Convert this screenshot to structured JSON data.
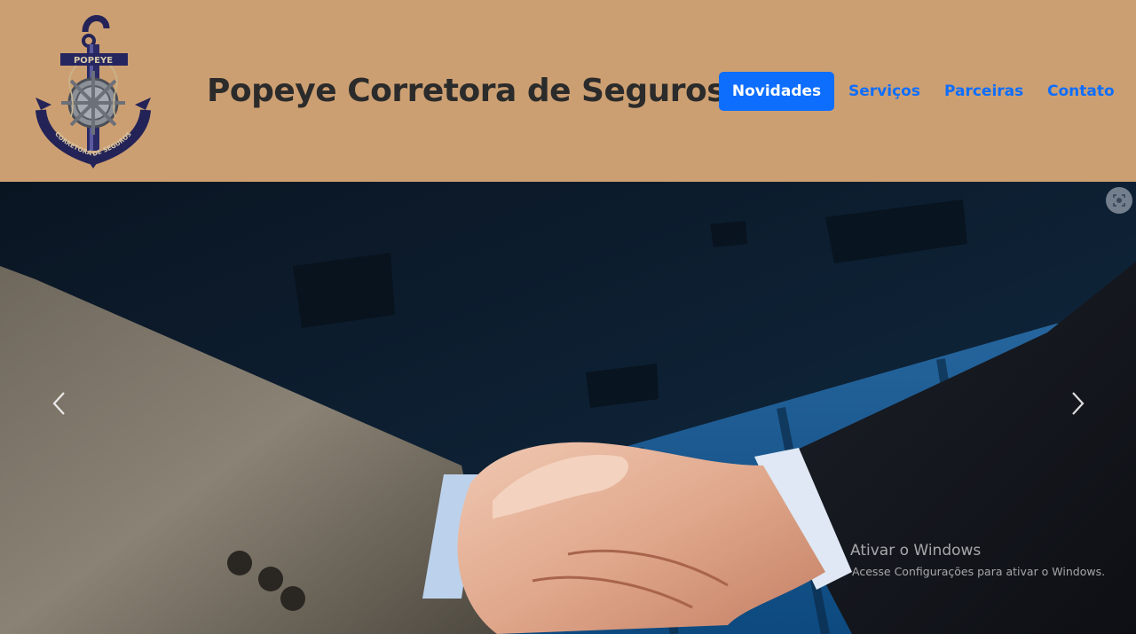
{
  "header": {
    "title": "Popeye Corretora de Seguros",
    "logo": {
      "icon": "anchor-icon",
      "top_text": "POPEYE",
      "bottom_text": "CORRETORA DE SEGUROS"
    },
    "background_color": "#cc9f72"
  },
  "nav": {
    "items": [
      {
        "label": "Novidades",
        "active": true
      },
      {
        "label": "Serviços",
        "active": false
      },
      {
        "label": "Parceiras",
        "active": false
      },
      {
        "label": "Contato",
        "active": false
      }
    ],
    "accent_color": "#0d6efd"
  },
  "carousel": {
    "image": "handshake business photo",
    "prev_icon": "chevron-left-icon",
    "next_icon": "chevron-right-icon",
    "lens_icon": "visual-search-icon"
  },
  "watermark": {
    "title": "Ativar o Windows",
    "subtitle": "Acesse Configurações para ativar o Windows."
  }
}
